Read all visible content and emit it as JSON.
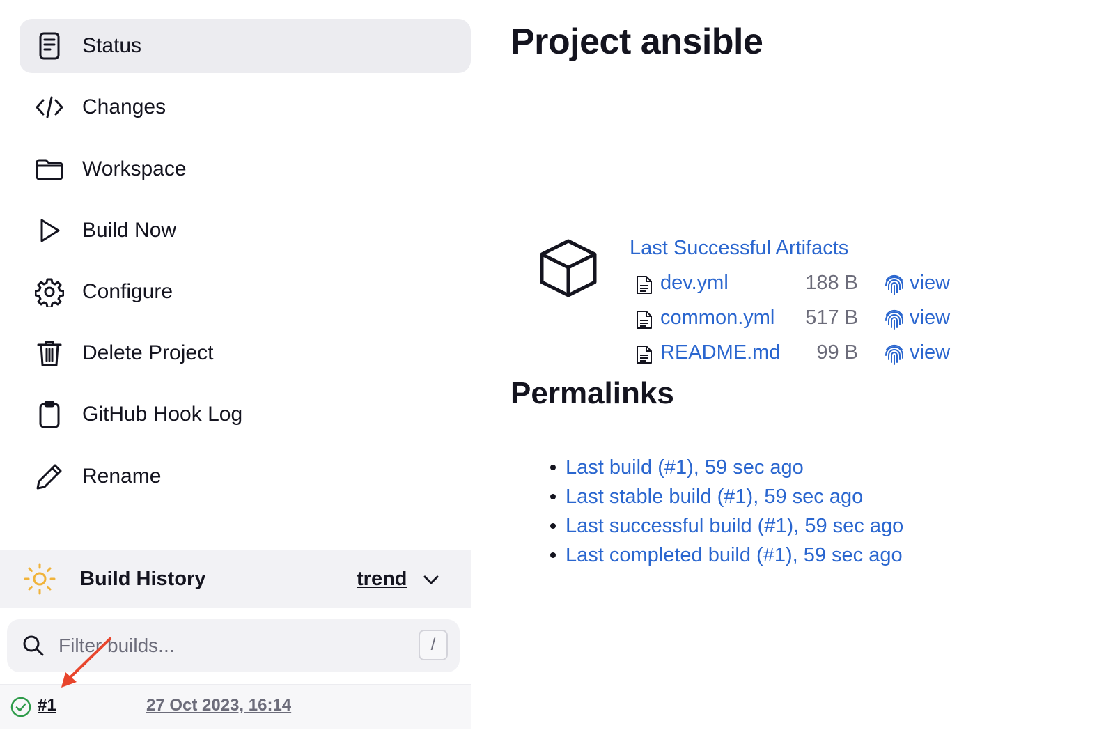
{
  "sidebar": {
    "items": [
      {
        "label": "Status",
        "icon": "status-icon",
        "active": true
      },
      {
        "label": "Changes",
        "icon": "code-icon"
      },
      {
        "label": "Workspace",
        "icon": "folder-icon"
      },
      {
        "label": "Build Now",
        "icon": "play-icon"
      },
      {
        "label": "Configure",
        "icon": "gear-icon"
      },
      {
        "label": "Delete Project",
        "icon": "trash-icon"
      },
      {
        "label": "GitHub Hook Log",
        "icon": "clipboard-icon"
      },
      {
        "label": "Rename",
        "icon": "pencil-icon"
      }
    ]
  },
  "build_history": {
    "title": "Build History",
    "trend_label": "trend",
    "filter_placeholder": "Filter builds...",
    "filter_shortcut": "/",
    "builds": [
      {
        "number": "#1",
        "date": "27 Oct 2023, 16:14",
        "status": "success"
      }
    ]
  },
  "main": {
    "title": "Project ansible",
    "artifacts": {
      "title": "Last Successful Artifacts",
      "files": [
        {
          "name": "dev.yml",
          "size": "188 B",
          "view_label": "view"
        },
        {
          "name": "common.yml",
          "size": "517 B",
          "view_label": "view"
        },
        {
          "name": "README.md",
          "size": "99 B",
          "view_label": "view"
        }
      ]
    },
    "permalinks": {
      "title": "Permalinks",
      "items": [
        "Last build (#1), 59 sec ago",
        "Last stable build (#1), 59 sec ago",
        "Last successful build (#1), 59 sec ago",
        "Last completed build (#1), 59 sec ago"
      ]
    }
  },
  "colors": {
    "link": "#2a66cf",
    "active_bg": "#ececf0",
    "success": "#2e9b4a",
    "sun": "#f0b33a",
    "annotation_arrow": "#e8452c"
  }
}
